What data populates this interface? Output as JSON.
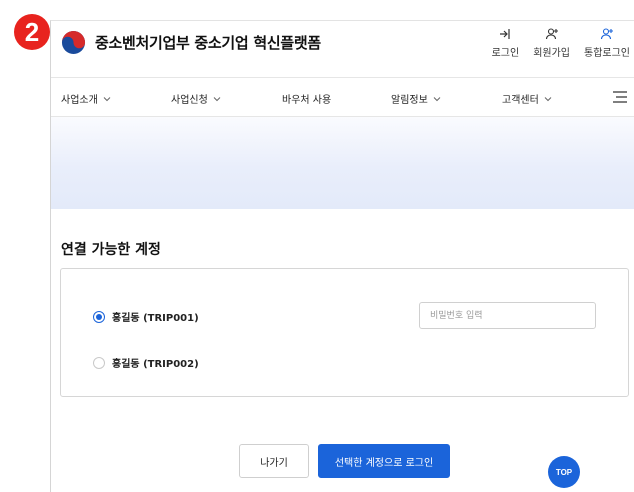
{
  "step_badge": "2",
  "header": {
    "logo_text": "중소벤처기업부 중소기업 혁신플랫폼",
    "util": [
      {
        "label": "로그인",
        "icon": "login-icon"
      },
      {
        "label": "회원가입",
        "icon": "user-plus-icon"
      },
      {
        "label": "통합로그인",
        "icon": "users-plus-icon"
      }
    ]
  },
  "nav": {
    "items": [
      {
        "label": "사업소개",
        "dropdown": true
      },
      {
        "label": "사업신청",
        "dropdown": true
      },
      {
        "label": "바우처 사용",
        "dropdown": false
      },
      {
        "label": "알림정보",
        "dropdown": true
      },
      {
        "label": "고객센터",
        "dropdown": true
      }
    ]
  },
  "main": {
    "section_title": "연결 가능한 계정",
    "accounts": [
      {
        "label": "홍길동 (TRIP001)",
        "selected": true
      },
      {
        "label": "홍길동 (TRIP002)",
        "selected": false
      }
    ],
    "password_placeholder": "비밀번호 입력",
    "exit_label": "나가기",
    "login_label": "선택한 계정으로 로그인",
    "top_label": "TOP"
  },
  "colors": {
    "accent": "#1b64da",
    "badge": "#e8231e"
  }
}
